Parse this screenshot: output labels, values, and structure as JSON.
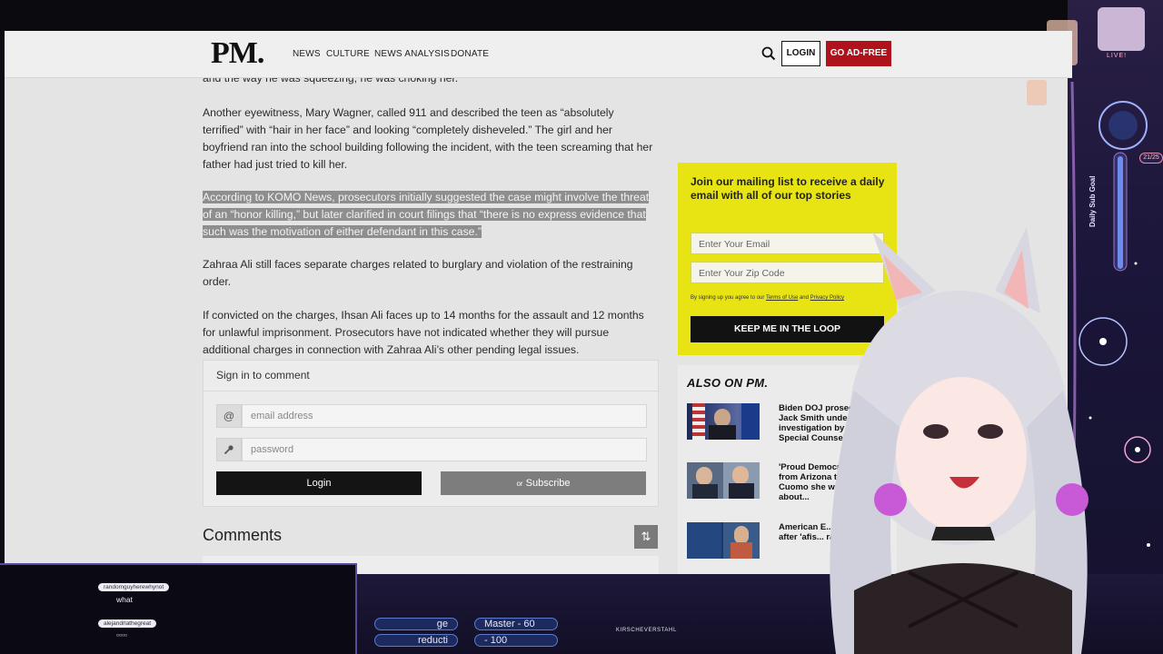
{
  "site": {
    "logo": "PM.",
    "nav": [
      "NEWS",
      "CULTURE",
      "NEWS ANALYSIS",
      "DONATE"
    ],
    "login": "LOGIN",
    "adfree": "GO AD-FREE"
  },
  "article": {
    "p0": "and the way he was squeezing, he was choking her.",
    "p1": "Another eyewitness, Mary Wagner, called 911 and described the teen as “absolutely terrified” with “hair in her face” and looking “completely disheveled.” The girl and her boyfriend ran into the school building following the incident, with the teen screaming that her father had just tried to kill her.",
    "p2": "According to KOMO News, prosecutors initially suggested the case might involve the threat of an “honor killing,” but later clarified in court filings that “there is no express evidence that such was the motivation of either defendant in this case.”",
    "p3": "Zahraa Ali still faces separate charges related to burglary and violation of the restraining order.",
    "p4": "If convicted on the charges, Ihsan Ali faces up to 14 months for the assault and 12 months for unlawful imprisonment. Prosecutors have not indicated whether they will pursue additional charges in connection with Zahraa Ali’s other pending legal issues."
  },
  "comments": {
    "signin": "Sign in to comment",
    "email_placeholder": "email address",
    "password_placeholder": "password",
    "login": "Login",
    "subscribe_or": "or",
    "subscribe": "Subscribe",
    "heading": "Comments"
  },
  "mailing": {
    "title": "Join our mailing list to receive a daily email with all of our top stories",
    "email_placeholder": "Enter Your Email",
    "zip_placeholder": "Enter Your Zip Code",
    "fine_prefix": "By signing up you agree to our",
    "terms": "Terms of Use",
    "and": "and",
    "privacy": "Privacy Policy",
    "button": "KEEP ME IN THE LOOP"
  },
  "also_on": {
    "title": "ALSO ON PM.",
    "stories": [
      "Biden DOJ prosecutor Jack Smith under investigation by Office of Special Counsel",
      "'Proud Democrat' woman from Arizona tells Chris Cuomo she was 'wrong about...",
      "American E... up for Syd... after 'afis... racis... v..."
    ]
  },
  "stream": {
    "live": "LIVE!",
    "sub_goal": "Daily Sub Goal",
    "sub_count": "21/25",
    "chat": [
      {
        "user": "randomguyherewhynot",
        "msg": "what"
      },
      {
        "user": "alejandrlathegreat",
        "msg": "▫▫▫▫"
      }
    ],
    "pills": [
      "ge",
      "reducti",
      "Master - 60",
      "- 100"
    ],
    "twitter": "KIRSCHEVERSTAHL"
  },
  "colors": {
    "adfree": "#b0121c",
    "mailing_bg": "#e8e414",
    "highlight": "#8e8e8e"
  }
}
